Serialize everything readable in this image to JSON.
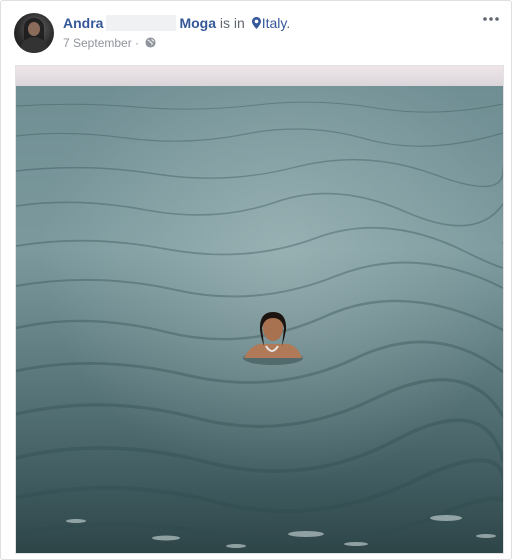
{
  "post": {
    "author_first": "Andra",
    "author_last": "Moga",
    "location_verb": " is in ",
    "location_name": "Italy",
    "location_suffix": ".",
    "date": "7 September",
    "separator": " · ",
    "privacy_icon": "globe-icon",
    "options_icon": "more-options-icon",
    "photo_description": "woman-swimming-in-sea"
  },
  "colors": {
    "link": "#365899",
    "muted": "#90949c",
    "sea": "#4f6b6e",
    "sky": "#e9e1e3"
  }
}
